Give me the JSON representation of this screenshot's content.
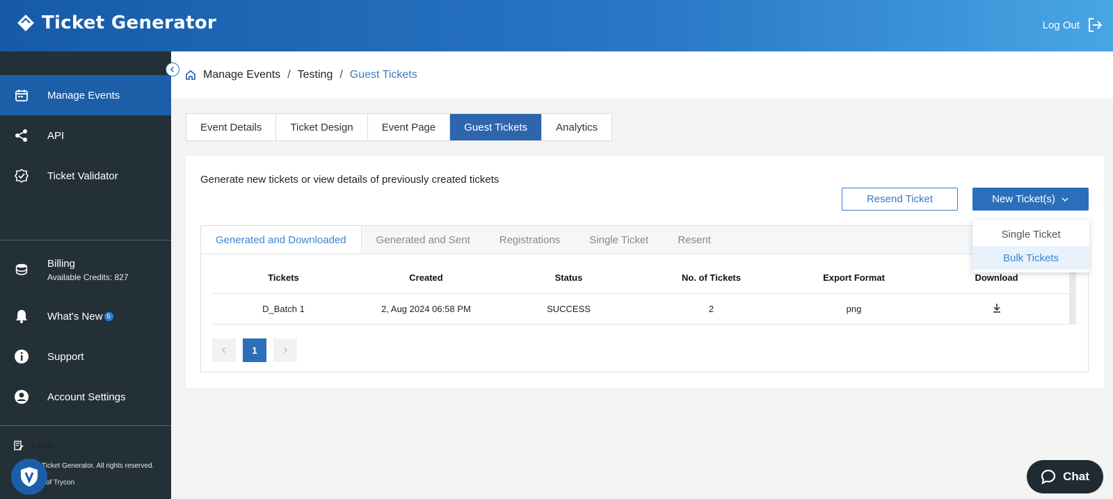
{
  "header": {
    "brand_name": "Ticket Generator",
    "logout_label": "Log Out"
  },
  "sidebar": {
    "items": [
      {
        "label": "Manage Events",
        "icon": "calendar-icon"
      },
      {
        "label": "API",
        "icon": "share-nodes-icon"
      },
      {
        "label": "Ticket Validator",
        "icon": "badge-check-icon"
      }
    ],
    "billing": {
      "label": "Billing",
      "credits": "Available Credits: 827",
      "icon": "coins-icon"
    },
    "whats_new": {
      "label": "What's New",
      "badge": "5",
      "icon": "bell-icon"
    },
    "support": {
      "label": "Support",
      "icon": "info-icon"
    },
    "account": {
      "label": "Account Settings",
      "icon": "user-circle-icon"
    },
    "legal": {
      "label": "Legal",
      "icon": "document-edit-icon"
    },
    "footer_line1": "Ticket Generator. All rights reserved.",
    "footer_line2": "of Trycon"
  },
  "breadcrumb": {
    "items": [
      "Manage Events",
      "Testing",
      "Guest Tickets"
    ],
    "separator": "/"
  },
  "tabs": [
    "Event Details",
    "Ticket Design",
    "Event Page",
    "Guest Tickets",
    "Analytics"
  ],
  "active_tab": "Guest Tickets",
  "card": {
    "description": "Generate new tickets or view details of previously created tickets",
    "resend_label": "Resend Ticket",
    "new_label": "New Ticket(s)"
  },
  "subtabs": [
    "Generated and Downloaded",
    "Generated and Sent",
    "Registrations",
    "Single Ticket",
    "Resent"
  ],
  "active_subtab": "Generated and Downloaded",
  "table": {
    "headers": [
      "Tickets",
      "Created",
      "Status",
      "No. of Tickets",
      "Export Format",
      "Download"
    ],
    "rows": [
      {
        "tickets": "D_Batch 1",
        "created": "2, Aug 2024 06:58 PM",
        "status": "SUCCESS",
        "count": "2",
        "format": "png"
      }
    ]
  },
  "pagination": {
    "current": "1"
  },
  "dropdown": {
    "items": [
      "Single Ticket",
      "Bulk Tickets"
    ],
    "highlighted": "Bulk Tickets"
  },
  "chat": {
    "label": "Chat"
  },
  "colors": {
    "primary": "#2b6fbb",
    "sidebar_bg": "#243038",
    "active_nav": "#1d5ea8",
    "link": "#3d84d0"
  }
}
